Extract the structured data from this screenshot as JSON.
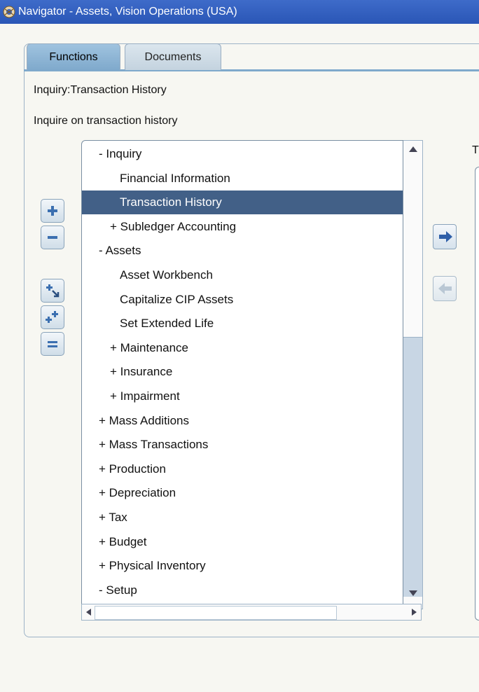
{
  "window": {
    "title": "Navigator - Assets, Vision Operations (USA)"
  },
  "tabs": [
    {
      "label": "Functions",
      "active": true
    },
    {
      "label": "Documents",
      "active": false
    }
  ],
  "info": {
    "function_name": "Inquiry:Transaction History",
    "description": "Inquire on transaction history"
  },
  "right_panel": {
    "partial_label": "T"
  },
  "tree": {
    "items": [
      {
        "label": "- Inquiry",
        "indent": 0
      },
      {
        "label": "Financial Information",
        "indent": 2
      },
      {
        "label": "Transaction History",
        "indent": 2,
        "selected": true
      },
      {
        "label": "+ Subledger Accounting",
        "indent": 1
      },
      {
        "label": "- Assets",
        "indent": 0
      },
      {
        "label": "Asset Workbench",
        "indent": 2
      },
      {
        "label": "Capitalize CIP Assets",
        "indent": 2
      },
      {
        "label": "Set Extended Life",
        "indent": 2
      },
      {
        "label": "+ Maintenance",
        "indent": 1
      },
      {
        "label": "+ Insurance",
        "indent": 1
      },
      {
        "label": "+ Impairment",
        "indent": 1
      },
      {
        "label": "+ Mass Additions",
        "indent": 0
      },
      {
        "label": "+ Mass Transactions",
        "indent": 0
      },
      {
        "label": "+ Production",
        "indent": 0
      },
      {
        "label": "+ Depreciation",
        "indent": 0
      },
      {
        "label": "+ Tax",
        "indent": 0
      },
      {
        "label": "+ Budget",
        "indent": 0
      },
      {
        "label": "+ Physical Inventory",
        "indent": 0
      },
      {
        "label": "- Setup",
        "indent": 0
      }
    ]
  },
  "icons": {
    "title": "oracle-app-icon",
    "expand": "plus-icon",
    "collapse": "minus-icon",
    "expand_branch": "expand-branch-icon",
    "expand_all": "expand-all-icon",
    "collapse_all": "collapse-all-icon",
    "add_to_top_ten": "right-arrow-icon",
    "remove_from_top_ten": "left-arrow-icon"
  },
  "colors": {
    "titlebar": "#2f5cbf",
    "selection": "#426087",
    "tab_active": "#8fb6d6"
  }
}
